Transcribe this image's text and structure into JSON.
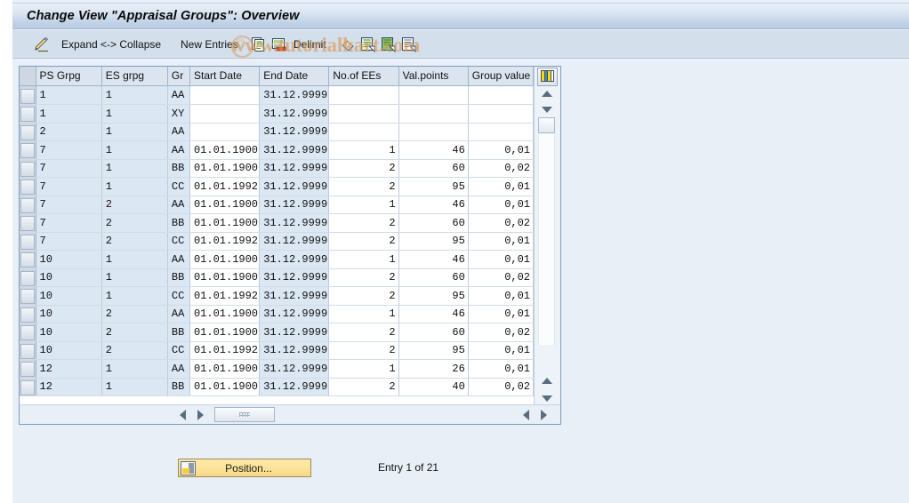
{
  "window": {
    "title": "Change View \"Appraisal Groups\": Overview"
  },
  "watermark": {
    "text": "www.tutorialkart.com",
    "mark": "©"
  },
  "toolbar": {
    "items": [
      {
        "name": "edit-pencil-icon",
        "label": "",
        "icon": "pencil-icon"
      },
      {
        "name": "expand-collapse-button",
        "label": "Expand <-> Collapse",
        "icon": ""
      },
      {
        "name": "new-entries-button",
        "label": "New Entries",
        "icon": ""
      },
      {
        "name": "copy-as-button",
        "label": "",
        "icon": "copy-icon"
      },
      {
        "name": "delete-button",
        "label": "",
        "icon": "delete-icon"
      },
      {
        "name": "delimit-button",
        "label": "Delimit",
        "icon": ""
      },
      {
        "name": "undo-button",
        "label": "",
        "icon": "undo-icon"
      },
      {
        "name": "previous-entry-button",
        "label": "",
        "icon": "prev-entry-icon"
      },
      {
        "name": "next-entry-button",
        "label": "",
        "icon": "next-entry-icon"
      },
      {
        "name": "details-button",
        "label": "",
        "icon": "details-icon"
      }
    ]
  },
  "table": {
    "columns": [
      {
        "key": "ps_grpg",
        "label": "PS Grpg",
        "width": 74,
        "align": "left",
        "type": "key"
      },
      {
        "key": "es_grpg",
        "label": "ES grpg",
        "width": 74,
        "align": "left",
        "type": "key"
      },
      {
        "key": "gr",
        "label": "Gr",
        "width": 25,
        "align": "left",
        "type": "key"
      },
      {
        "key": "start_date",
        "label": "Start Date",
        "width": 78,
        "align": "left",
        "type": "plain"
      },
      {
        "key": "end_date",
        "label": "End Date",
        "width": 78,
        "align": "left",
        "type": "key"
      },
      {
        "key": "no_of_ees",
        "label": "No.of EEs",
        "width": 78,
        "align": "right",
        "type": "num"
      },
      {
        "key": "val_points",
        "label": "Val.points",
        "width": 78,
        "align": "right",
        "type": "num"
      },
      {
        "key": "group_value",
        "label": "Group value",
        "width": 73,
        "align": "right",
        "type": "num"
      }
    ],
    "rows": [
      {
        "ps_grpg": "1",
        "es_grpg": "1",
        "gr": "AA",
        "start_date": "",
        "end_date": "31.12.9999",
        "no_of_ees": "",
        "val_points": "",
        "group_value": ""
      },
      {
        "ps_grpg": "1",
        "es_grpg": "1",
        "gr": "XY",
        "start_date": "",
        "end_date": "31.12.9999",
        "no_of_ees": "",
        "val_points": "",
        "group_value": ""
      },
      {
        "ps_grpg": "2",
        "es_grpg": "1",
        "gr": "AA",
        "start_date": "",
        "end_date": "31.12.9999",
        "no_of_ees": "",
        "val_points": "",
        "group_value": ""
      },
      {
        "ps_grpg": "7",
        "es_grpg": "1",
        "gr": "AA",
        "start_date": "01.01.1900",
        "end_date": "31.12.9999",
        "no_of_ees": "1",
        "val_points": "46",
        "group_value": "0,01"
      },
      {
        "ps_grpg": "7",
        "es_grpg": "1",
        "gr": "BB",
        "start_date": "01.01.1900",
        "end_date": "31.12.9999",
        "no_of_ees": "2",
        "val_points": "60",
        "group_value": "0,02"
      },
      {
        "ps_grpg": "7",
        "es_grpg": "1",
        "gr": "CC",
        "start_date": "01.01.1992",
        "end_date": "31.12.9999",
        "no_of_ees": "2",
        "val_points": "95",
        "group_value": "0,01"
      },
      {
        "ps_grpg": "7",
        "es_grpg": "2",
        "gr": "AA",
        "start_date": "01.01.1900",
        "end_date": "31.12.9999",
        "no_of_ees": "1",
        "val_points": "46",
        "group_value": "0,01"
      },
      {
        "ps_grpg": "7",
        "es_grpg": "2",
        "gr": "BB",
        "start_date": "01.01.1900",
        "end_date": "31.12.9999",
        "no_of_ees": "2",
        "val_points": "60",
        "group_value": "0,02"
      },
      {
        "ps_grpg": "7",
        "es_grpg": "2",
        "gr": "CC",
        "start_date": "01.01.1992",
        "end_date": "31.12.9999",
        "no_of_ees": "2",
        "val_points": "95",
        "group_value": "0,01"
      },
      {
        "ps_grpg": "10",
        "es_grpg": "1",
        "gr": "AA",
        "start_date": "01.01.1900",
        "end_date": "31.12.9999",
        "no_of_ees": "1",
        "val_points": "46",
        "group_value": "0,01"
      },
      {
        "ps_grpg": "10",
        "es_grpg": "1",
        "gr": "BB",
        "start_date": "01.01.1900",
        "end_date": "31.12.9999",
        "no_of_ees": "2",
        "val_points": "60",
        "group_value": "0,02"
      },
      {
        "ps_grpg": "10",
        "es_grpg": "1",
        "gr": "CC",
        "start_date": "01.01.1992",
        "end_date": "31.12.9999",
        "no_of_ees": "2",
        "val_points": "95",
        "group_value": "0,01"
      },
      {
        "ps_grpg": "10",
        "es_grpg": "2",
        "gr": "AA",
        "start_date": "01.01.1900",
        "end_date": "31.12.9999",
        "no_of_ees": "1",
        "val_points": "46",
        "group_value": "0,01"
      },
      {
        "ps_grpg": "10",
        "es_grpg": "2",
        "gr": "BB",
        "start_date": "01.01.1900",
        "end_date": "31.12.9999",
        "no_of_ees": "2",
        "val_points": "60",
        "group_value": "0,02"
      },
      {
        "ps_grpg": "10",
        "es_grpg": "2",
        "gr": "CC",
        "start_date": "01.01.1992",
        "end_date": "31.12.9999",
        "no_of_ees": "2",
        "val_points": "95",
        "group_value": "0,01"
      },
      {
        "ps_grpg": "12",
        "es_grpg": "1",
        "gr": "AA",
        "start_date": "01.01.1900",
        "end_date": "31.12.9999",
        "no_of_ees": "1",
        "val_points": "26",
        "group_value": "0,01"
      },
      {
        "ps_grpg": "12",
        "es_grpg": "1",
        "gr": "BB",
        "start_date": "01.01.1900",
        "end_date": "31.12.9999",
        "no_of_ees": "2",
        "val_points": "40",
        "group_value": "0,02"
      }
    ]
  },
  "footer": {
    "position_button_label": "Position...",
    "entry_status": "Entry 1 of 21"
  },
  "colors": {
    "title_bar_accent": "#bfd1e5",
    "toolbar_bg": "#d3dfeb",
    "page_bg": "#e9eff7",
    "key_cell_bg": "#dbe7f3",
    "header_bg": "#dbe4ef",
    "button_yellow": "#fde39b",
    "watermark": "#d69650"
  }
}
